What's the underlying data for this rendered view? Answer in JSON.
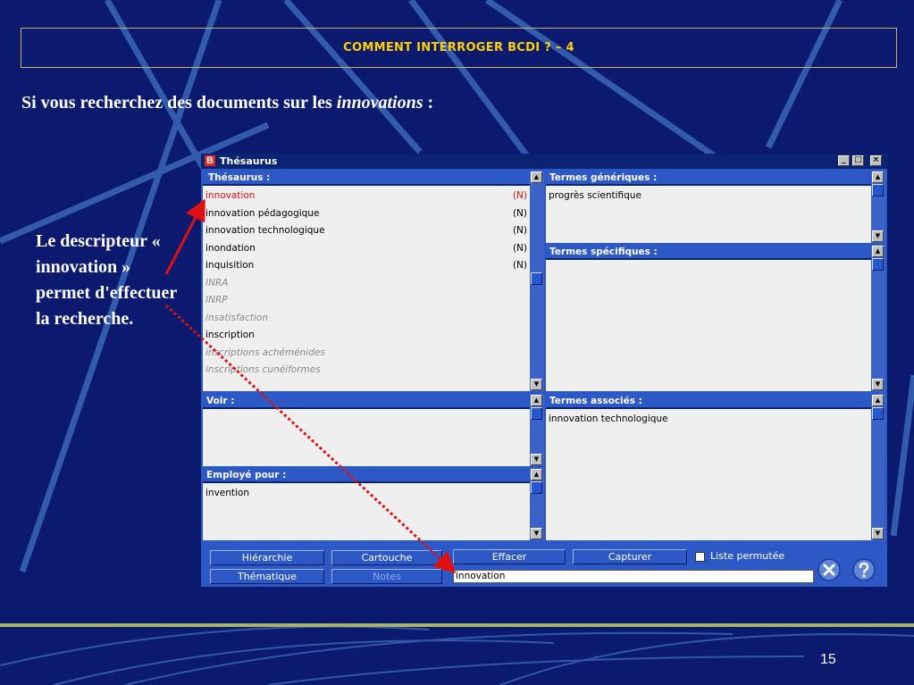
{
  "slide": {
    "title": "COMMENT INTERROGER BCDI ? – 4",
    "intro_prefix": "Si vous recherchez des documents sur les ",
    "intro_italic": "innovations",
    "intro_suffix": " :",
    "side_note": "Le descripteur « innovation » permet d'effectuer la recherche.",
    "page_number": "15"
  },
  "window": {
    "icon_letter": "B",
    "title": "Thésaurus",
    "controls": [
      "_",
      "□",
      "×"
    ]
  },
  "thesaurus": {
    "header": "Thésaurus  :",
    "items": [
      {
        "label": "innovation",
        "tag": "(N)",
        "style": "red"
      },
      {
        "label": "innovation pédagogique",
        "tag": "(N)",
        "style": "normal"
      },
      {
        "label": "innovation technologique",
        "tag": "(N)",
        "style": "normal"
      },
      {
        "label": "inondation",
        "tag": "(N)",
        "style": "normal"
      },
      {
        "label": "inquisition",
        "tag": "(N)",
        "style": "normal"
      },
      {
        "label": "INRA",
        "tag": "",
        "style": "gray"
      },
      {
        "label": "INRP",
        "tag": "",
        "style": "gray"
      },
      {
        "label": "insatisfaction",
        "tag": "",
        "style": "gray"
      },
      {
        "label": "inscription",
        "tag": "",
        "style": "normal"
      },
      {
        "label": "inscriptions achéménides",
        "tag": "",
        "style": "gray"
      },
      {
        "label": "inscriptions cunéiformes",
        "tag": "",
        "style": "gray"
      }
    ]
  },
  "generic_terms": {
    "header": "Termes génériques :",
    "items": [
      "progrès scientifique"
    ]
  },
  "specific_terms": {
    "header": "Termes spécifiques :",
    "items": []
  },
  "voir": {
    "header": "Voir :",
    "items": []
  },
  "employe_pour": {
    "header": "Employé pour :",
    "items": [
      "invention"
    ]
  },
  "associated_terms": {
    "header": "Termes associés :",
    "items": [
      "innovation technologique"
    ]
  },
  "buttons": {
    "hierarchie": "Hiérarchie",
    "cartouche": "Cartouche",
    "effacer": "Effacer",
    "capturer": "Capturer",
    "thematique": "Thématique",
    "notes": "Notes",
    "liste_permutee": "Liste permutée"
  },
  "search": {
    "value": "innovation"
  },
  "colors": {
    "slide_bg": "#0b1a6e",
    "title_text": "#ffd000",
    "window_blue": "#2d59c7",
    "selected_red": "#e01010"
  }
}
